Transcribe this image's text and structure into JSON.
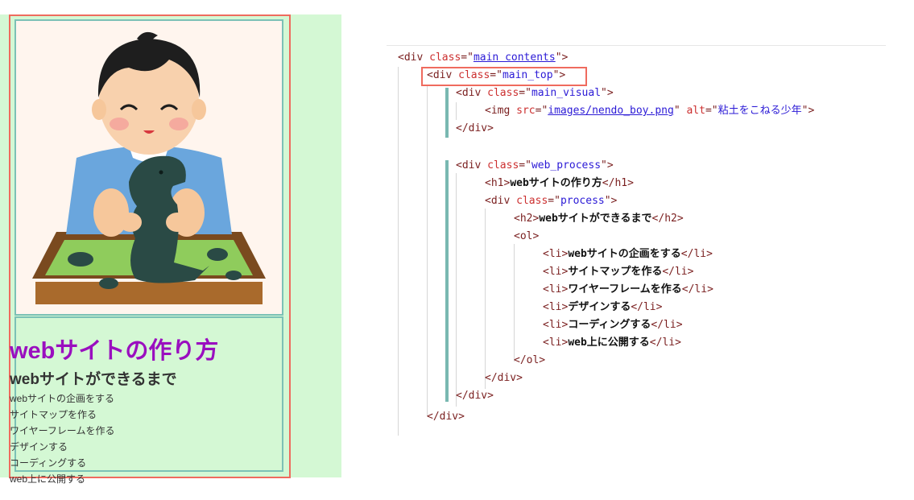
{
  "preview": {
    "heading": "webサイトの作り方",
    "subheading": "webサイトができるまで",
    "steps": [
      "webサイトの企画をする",
      "サイトマップを作る",
      "ワイヤーフレームを作る",
      "デザインする",
      "コーディングする",
      "web上に公開する"
    ]
  },
  "code": {
    "l1": {
      "open": "<div ",
      "attr": "class",
      "eq": "=\"",
      "val": "main contents",
      "close": "\">"
    },
    "l2": {
      "open": "<div ",
      "attr": "class",
      "eq": "=\"",
      "val": "main_top",
      "close": "\">"
    },
    "l3": {
      "open": "<div ",
      "attr": "class",
      "eq": "=\"",
      "val": "main_visual",
      "close": "\">"
    },
    "l4": {
      "open": "<img ",
      "attr1": "src",
      "eq1": "=\"",
      "val1": "images/nendo_boy.png",
      "q1": "\" ",
      "attr2": "alt",
      "eq2": "=\"",
      "val2": "粘土をこねる少年",
      "close": "\">"
    },
    "l5": "</div>",
    "l6": {
      "open": "<div ",
      "attr": "class",
      "eq": "=\"",
      "val": "web_process",
      "close": "\">"
    },
    "l7": {
      "open": "<h1>",
      "text": "webサイトの作り方",
      "close": "</h1>"
    },
    "l8": {
      "open": "<div ",
      "attr": "class",
      "eq": "=\"",
      "val": "process",
      "close": "\">"
    },
    "l9": {
      "open": "<h2>",
      "text": "webサイトができるまで",
      "close": "</h2>"
    },
    "l10": "<ol>",
    "li": [
      {
        "open": "<li>",
        "text": "webサイトの企画をする",
        "close": "</li>"
      },
      {
        "open": "<li>",
        "text": "サイトマップを作る",
        "close": "</li>"
      },
      {
        "open": "<li>",
        "text": "ワイヤーフレームを作る",
        "close": "</li>"
      },
      {
        "open": "<li>",
        "text": "デザインする",
        "close": "</li>"
      },
      {
        "open": "<li>",
        "text": "コーディングする",
        "close": "</li>"
      },
      {
        "open": "<li>",
        "text": "web上に公開する",
        "close": "</li>"
      }
    ],
    "l17": "</ol>",
    "l18": "</div>",
    "l19": "</div>",
    "l20": "</div>"
  },
  "colors": {
    "highlight": "#ef6b5e",
    "block_border": "#7cc1b6",
    "preview_bg": "#d4f8d4",
    "heading": "#9a0fbf"
  }
}
